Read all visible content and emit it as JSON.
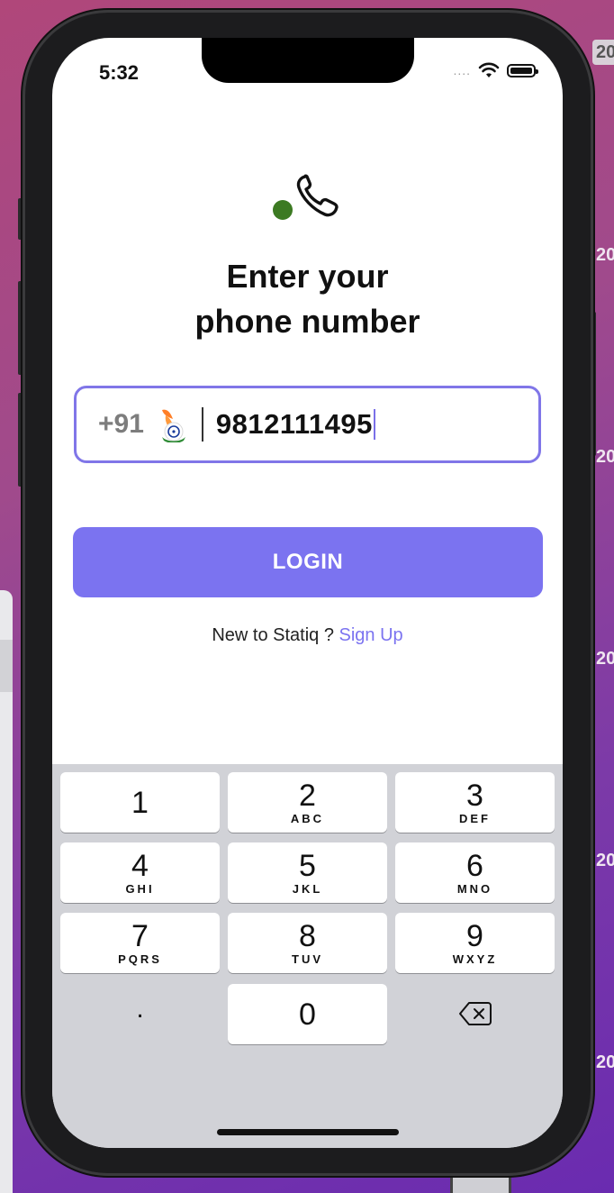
{
  "background": {
    "side_labels": [
      "20",
      "20",
      "20",
      "20",
      "20",
      "20"
    ],
    "tag_label": "20"
  },
  "status_bar": {
    "time": "5:32",
    "signal": "....",
    "wifi_icon": "wifi-icon",
    "battery_icon": "battery-icon"
  },
  "logo": {
    "dot_color": "#3c7a22",
    "icon": "phone-icon"
  },
  "title_line1": "Enter your",
  "title_line2": "phone number",
  "phone_field": {
    "country_code": "+91",
    "flag_icon": "india-flag-icon",
    "value": "9812111495"
  },
  "login_button": "LOGIN",
  "signup": {
    "prompt": "New to Statiq ?",
    "link": "Sign Up"
  },
  "keypad": [
    {
      "digit": "1",
      "letters": ""
    },
    {
      "digit": "2",
      "letters": "ABC"
    },
    {
      "digit": "3",
      "letters": "DEF"
    },
    {
      "digit": "4",
      "letters": "GHI"
    },
    {
      "digit": "5",
      "letters": "JKL"
    },
    {
      "digit": "6",
      "letters": "MNO"
    },
    {
      "digit": "7",
      "letters": "PQRS"
    },
    {
      "digit": "8",
      "letters": "TUV"
    },
    {
      "digit": "9",
      "letters": "WXYZ"
    },
    {
      "digit": ".",
      "letters": ""
    },
    {
      "digit": "0",
      "letters": ""
    },
    {
      "digit": "",
      "letters": "",
      "icon": "backspace-icon"
    }
  ],
  "colors": {
    "accent": "#7b73f0",
    "input_border": "#8076e8",
    "keyboard_bg": "#d1d2d7"
  }
}
